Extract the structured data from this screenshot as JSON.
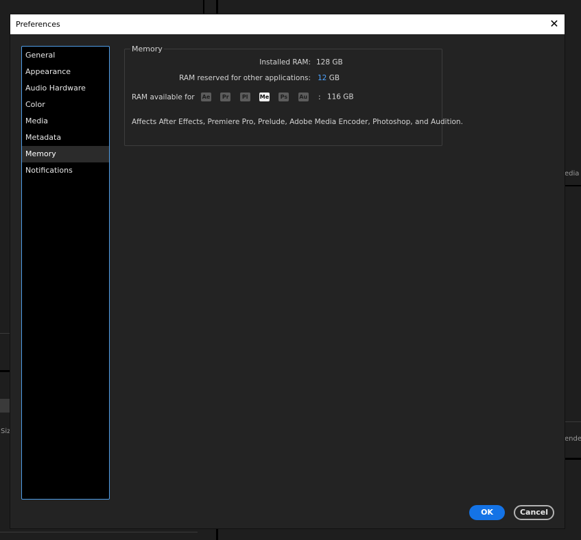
{
  "background_app": {
    "partial_labels": [
      "edia E",
      "ender",
      "Siz"
    ]
  },
  "dialog": {
    "title": "Preferences",
    "close_icon": "close-icon",
    "sidebar": {
      "items": [
        {
          "label": "General",
          "selected": false
        },
        {
          "label": "Appearance",
          "selected": false
        },
        {
          "label": "Audio Hardware",
          "selected": false
        },
        {
          "label": "Color",
          "selected": false
        },
        {
          "label": "Media",
          "selected": false
        },
        {
          "label": "Metadata",
          "selected": false
        },
        {
          "label": "Memory",
          "selected": true
        },
        {
          "label": "Notifications",
          "selected": false
        }
      ]
    },
    "memory": {
      "group_title": "Memory",
      "installed_ram_label": "Installed RAM:",
      "installed_ram_value": "128 GB",
      "reserved_label": "RAM reserved for other applications:",
      "reserved_value": "12",
      "reserved_unit": "GB",
      "available_label": "RAM available for",
      "apps": [
        {
          "abbr": "Ae",
          "active": false
        },
        {
          "abbr": "Pr",
          "active": false
        },
        {
          "abbr": "Pl",
          "active": false
        },
        {
          "abbr": "Me",
          "active": true
        },
        {
          "abbr": "Ps",
          "active": false
        },
        {
          "abbr": "Au",
          "active": false
        }
      ],
      "available_separator": ":",
      "available_value": "116 GB",
      "affects_note": "Affects After Effects, Premiere Pro, Prelude, Adobe Media Encoder, Photoshop, and Audition."
    },
    "buttons": {
      "ok_label": "OK",
      "cancel_label": "Cancel"
    },
    "colors": {
      "accent": "#1473e6",
      "value_accent": "#4ea3ff",
      "sidebar_border": "#4f9ee8"
    }
  }
}
